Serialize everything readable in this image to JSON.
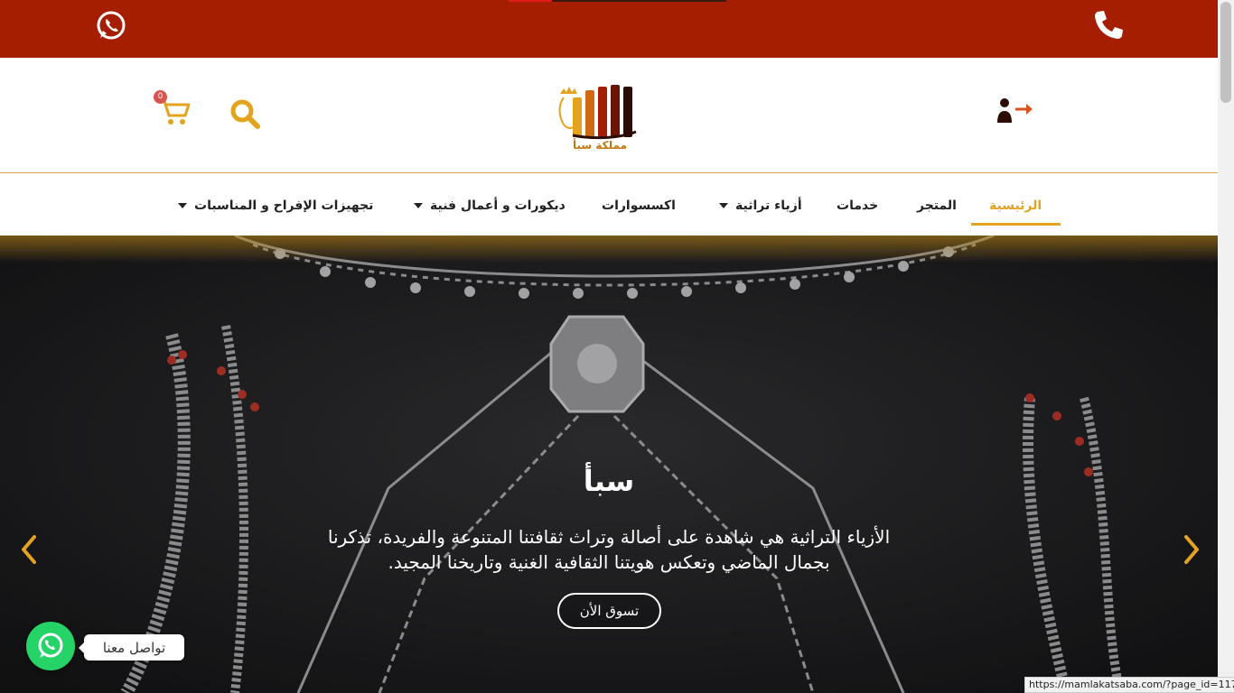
{
  "topbar": {
    "bg_color": "#A61E02",
    "whatsapp_icon": "whatsapp-icon",
    "phone_icon": "phone-icon"
  },
  "header": {
    "cart_count": "0",
    "logo_text": "مملكة سبأ",
    "accent_color": "#E4A31E"
  },
  "nav": {
    "items": [
      {
        "label": "الرئيسية",
        "active": true
      },
      {
        "label": "المتجر"
      },
      {
        "label": "خدمات"
      },
      {
        "label": "أزياء تراثية",
        "dropdown": true
      },
      {
        "label": "اكسسوارات"
      },
      {
        "label": "ديكورات و أعمال فنية",
        "dropdown": true
      },
      {
        "label": "تجهيزات الإفراح و المناسبات",
        "dropdown": true
      }
    ]
  },
  "hero": {
    "title": "سبأ",
    "text_line1": "الأزياء التراثية هي شاهدة على أصالة وتراث ثقافتنا المتنوعة والفريدة، تذكرنا",
    "text_line2": "بجمال الماضي وتعكس هويتنا الثقافية الغنية وتاريخنا المجيد.",
    "button": "تسوق الأن"
  },
  "chat": {
    "label": "تواصل معنا"
  },
  "status_url": "https://mamlakatsaba.com/?page_id=117"
}
